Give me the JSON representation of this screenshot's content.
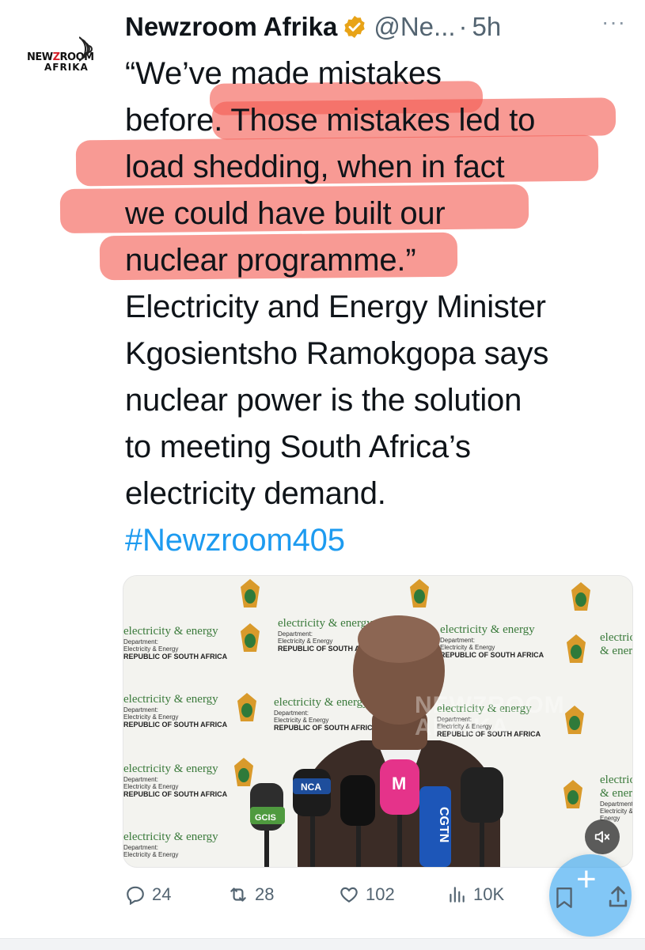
{
  "avatar": {
    "logo_line1_pre": "NEW",
    "logo_line1_z": "Z",
    "logo_line1_post": "ROOM",
    "logo_line2": "AFRIKA"
  },
  "header": {
    "name": "Newzroom Afrika",
    "handle": "@Ne...",
    "separator": "·",
    "time": "5h",
    "more": "···"
  },
  "tweet": {
    "lines": [
      "“We’ve made mistakes",
      "before. Those mistakes led to",
      "load shedding, when in fact",
      "we could have built our",
      "nuclear programme.”",
      "Electricity and Energy Minister",
      "Kgosientsho Ramokgopa says",
      "nuclear power is the solution",
      "to meeting South Africa’s",
      "electricity demand."
    ],
    "hashtag": "#Newzroom405",
    "highlight_color": "#f45c52"
  },
  "media": {
    "backdrop": {
      "brand": "electricity & energy",
      "dept": "Department:",
      "dept2": "Electricity & Energy",
      "country": "REPUBLIC OF SOUTH AFRICA"
    },
    "mic_labels": [
      "GCIS",
      "NCA",
      "M",
      "CGTN"
    ],
    "mute_icon": "speaker-muted-icon"
  },
  "actions": {
    "replies": "24",
    "reposts": "28",
    "likes": "102",
    "views": "10K"
  },
  "colors": {
    "accent": "#1d9bf0",
    "muted": "#536471"
  }
}
